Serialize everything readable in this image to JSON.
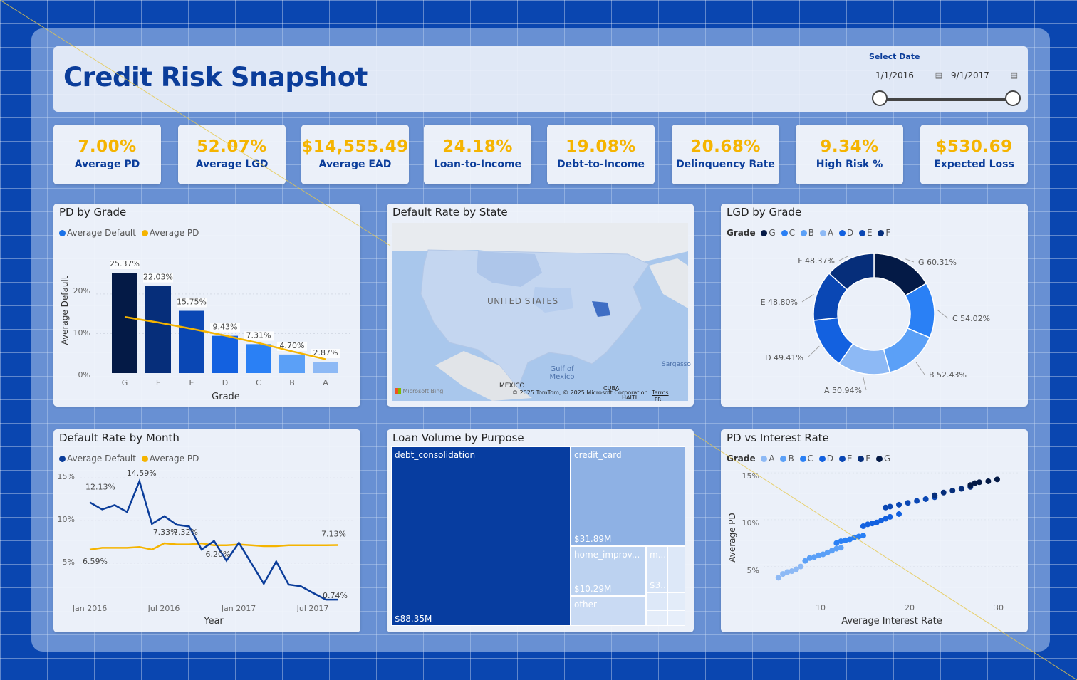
{
  "header": {
    "title": "Credit Risk Snapshot",
    "select_date_label": "Select Date",
    "start_date": "1/1/2016",
    "end_date": "9/1/2017",
    "calendar_icon": "calendar-icon"
  },
  "kpis": [
    {
      "value": "7.00%",
      "label": "Average PD"
    },
    {
      "value": "52.07%",
      "label": "Average LGD"
    },
    {
      "value": "$14,555.49",
      "label": "Average EAD"
    },
    {
      "value": "24.18%",
      "label": "Loan-to-Income"
    },
    {
      "value": "19.08%",
      "label": "Debt-to-Income"
    },
    {
      "value": "20.68%",
      "label": "Delinquency Rate"
    },
    {
      "value": "9.34%",
      "label": "High Risk %"
    },
    {
      "value": "$530.69",
      "label": "Expected Loss"
    }
  ],
  "colors": {
    "accent": "#0b3d9a",
    "kpi_value": "#f5b400",
    "avg_pd_line": "#f5b400",
    "grade_palette": [
      "#041a46",
      "#062e7a",
      "#0a47b4",
      "#1361e0",
      "#2a80f5",
      "#5ba0f7",
      "#8db9f5"
    ]
  },
  "pd_by_grade": {
    "title": "PD by Grade",
    "legend": [
      "Average Default",
      "Average PD"
    ],
    "xlabel": "Grade",
    "ylabel": "Average Default",
    "yticks": [
      "0%",
      "10%",
      "20%"
    ]
  },
  "default_by_state": {
    "title": "Default Rate by State",
    "labels": {
      "country": "UNITED STATES",
      "mexico": "MEXICO",
      "gulf": "Gulf of Mexico",
      "cuba": "CUBA",
      "haiti": "HAITI",
      "sargasso": "Sargasso",
      "pr": "PR"
    },
    "attribution": "© 2025 TomTom, © 2025 Microsoft Corporation",
    "terms": "Terms",
    "brand": "Microsoft Bing"
  },
  "lgd_by_grade": {
    "title": "LGD by Grade",
    "legend_title": "Grade",
    "legend": [
      "G",
      "C",
      "B",
      "A",
      "D",
      "E",
      "F"
    ]
  },
  "default_by_month": {
    "title": "Default Rate by Month",
    "legend": [
      "Average Default",
      "Average PD"
    ],
    "xlabel": "Year",
    "yticks": [
      "5%",
      "10%",
      "15%"
    ],
    "xticks": [
      "Jan 2016",
      "Jul 2016",
      "Jan 2017",
      "Jul 2017"
    ]
  },
  "loan_volume_by_purpose": {
    "title": "Loan Volume by Purpose",
    "cells": [
      {
        "name": "debt_consolidation",
        "value": "$88.35M"
      },
      {
        "name": "credit_card",
        "value": "$31.89M"
      },
      {
        "name": "home_improv...",
        "value": "$10.29M"
      },
      {
        "name": "m...",
        "value": "$3..."
      },
      {
        "name": "other",
        "value": ""
      }
    ]
  },
  "pd_vs_interest": {
    "title": "PD vs Interest Rate",
    "legend_title": "Grade",
    "legend": [
      "A",
      "B",
      "C",
      "D",
      "E",
      "F",
      "G"
    ],
    "xlabel": "Average Interest Rate",
    "ylabel": "Average PD",
    "xticks": [
      "10",
      "20",
      "30"
    ],
    "yticks": [
      "5%",
      "10%",
      "15%"
    ]
  },
  "chart_data": [
    {
      "type": "bar",
      "title": "PD by Grade",
      "categories": [
        "G",
        "F",
        "E",
        "D",
        "C",
        "B",
        "A"
      ],
      "series": [
        {
          "name": "Average Default",
          "values": [
            25.37,
            22.03,
            15.75,
            9.43,
            7.31,
            4.7,
            2.87
          ]
        },
        {
          "name": "Average PD",
          "values": [
            14.2,
            12.8,
            11.2,
            9.5,
            7.6,
            5.5,
            3.5
          ]
        }
      ],
      "data_labels": [
        "25.37%",
        "22.03%",
        "15.75%",
        "9.43%",
        "7.31%",
        "4.70%",
        "2.87%"
      ],
      "xlabel": "Grade",
      "ylabel": "Average Default",
      "ylim": [
        0,
        27
      ]
    },
    {
      "type": "pie",
      "title": "LGD by Grade",
      "categories": [
        "G",
        "C",
        "B",
        "A",
        "D",
        "E",
        "F"
      ],
      "values": [
        60.31,
        54.02,
        52.43,
        50.94,
        49.41,
        48.8,
        48.37
      ],
      "data_labels": [
        "G 60.31%",
        "C 54.02%",
        "B 52.43%",
        "A 50.94%",
        "D 49.41%",
        "E 48.80%",
        "F 48.37%"
      ]
    },
    {
      "type": "line",
      "title": "Default Rate by Month",
      "x": [
        "2016-01",
        "2016-02",
        "2016-03",
        "2016-04",
        "2016-05",
        "2016-06",
        "2016-07",
        "2016-08",
        "2016-09",
        "2016-10",
        "2016-11",
        "2016-12",
        "2017-01",
        "2017-02",
        "2017-03",
        "2017-04",
        "2017-05",
        "2017-06",
        "2017-07",
        "2017-08",
        "2017-09"
      ],
      "series": [
        {
          "name": "Average Default",
          "values": [
            12.13,
            11.3,
            11.8,
            11.0,
            14.59,
            9.6,
            10.5,
            9.5,
            9.3,
            6.6,
            7.6,
            5.3,
            7.4,
            5.0,
            2.6,
            5.2,
            2.5,
            2.3,
            1.5,
            0.74,
            0.74
          ]
        },
        {
          "name": "Average PD",
          "values": [
            6.59,
            6.8,
            6.8,
            6.8,
            6.9,
            6.6,
            7.33,
            7.2,
            7.2,
            7.32,
            7.1,
            7.1,
            7.2,
            7.1,
            7.0,
            7.0,
            7.1,
            7.1,
            7.1,
            7.1,
            7.13
          ]
        }
      ],
      "data_labels": [
        "12.13%",
        "14.59%",
        "7.33%",
        "7.32%",
        "6.20%",
        "6.59%",
        "7.13%",
        "0.74%"
      ],
      "xlabel": "Year",
      "ylim": [
        0,
        15
      ]
    },
    {
      "type": "treemap",
      "title": "Loan Volume by Purpose",
      "categories": [
        "debt_consolidation",
        "credit_card",
        "home_improv...",
        "other"
      ],
      "values": [
        88.35,
        31.89,
        10.29,
        5.0
      ]
    },
    {
      "type": "scatter",
      "title": "PD vs Interest Rate",
      "xlabel": "Average Interest Rate",
      "ylabel": "Average PD",
      "xlim": [
        5,
        33
      ],
      "ylim": [
        2,
        16
      ],
      "series": [
        {
          "name": "A",
          "points": [
            [
              6.5,
              3.8
            ],
            [
              7,
              4.2
            ],
            [
              7.5,
              4.4
            ],
            [
              8,
              4.5
            ],
            [
              8.5,
              4.7
            ],
            [
              9,
              5.0
            ]
          ]
        },
        {
          "name": "B",
          "points": [
            [
              9.5,
              5.6
            ],
            [
              10,
              5.9
            ],
            [
              10.5,
              6.0
            ],
            [
              11,
              6.2
            ],
            [
              11.5,
              6.3
            ],
            [
              12,
              6.5
            ],
            [
              12.5,
              6.7
            ],
            [
              13,
              6.9
            ],
            [
              13.5,
              7.0
            ]
          ]
        },
        {
          "name": "C",
          "points": [
            [
              13,
              7.5
            ],
            [
              13.5,
              7.7
            ],
            [
              14,
              7.8
            ],
            [
              14.5,
              7.9
            ],
            [
              15,
              8.1
            ],
            [
              15.5,
              8.2
            ],
            [
              16,
              8.3
            ]
          ]
        },
        {
          "name": "D",
          "points": [
            [
              16,
              9.3
            ],
            [
              16.5,
              9.5
            ],
            [
              17,
              9.6
            ],
            [
              17.5,
              9.7
            ],
            [
              18,
              9.9
            ],
            [
              18.5,
              10.1
            ],
            [
              19,
              10.3
            ],
            [
              20,
              10.6
            ]
          ]
        },
        {
          "name": "E",
          "points": [
            [
              18.5,
              11.3
            ],
            [
              19,
              11.4
            ],
            [
              20,
              11.6
            ],
            [
              21,
              11.8
            ],
            [
              22,
              12.0
            ],
            [
              23,
              12.2
            ],
            [
              24,
              12.4
            ]
          ]
        },
        {
          "name": "F",
          "points": [
            [
              24,
              12.6
            ],
            [
              25,
              12.9
            ],
            [
              26,
              13.1
            ],
            [
              27,
              13.3
            ],
            [
              28,
              13.5
            ]
          ]
        },
        {
          "name": "G",
          "points": [
            [
              28,
              13.7
            ],
            [
              28.5,
              13.9
            ],
            [
              29,
              14.0
            ],
            [
              30,
              14.1
            ],
            [
              31,
              14.3
            ]
          ]
        }
      ]
    }
  ]
}
